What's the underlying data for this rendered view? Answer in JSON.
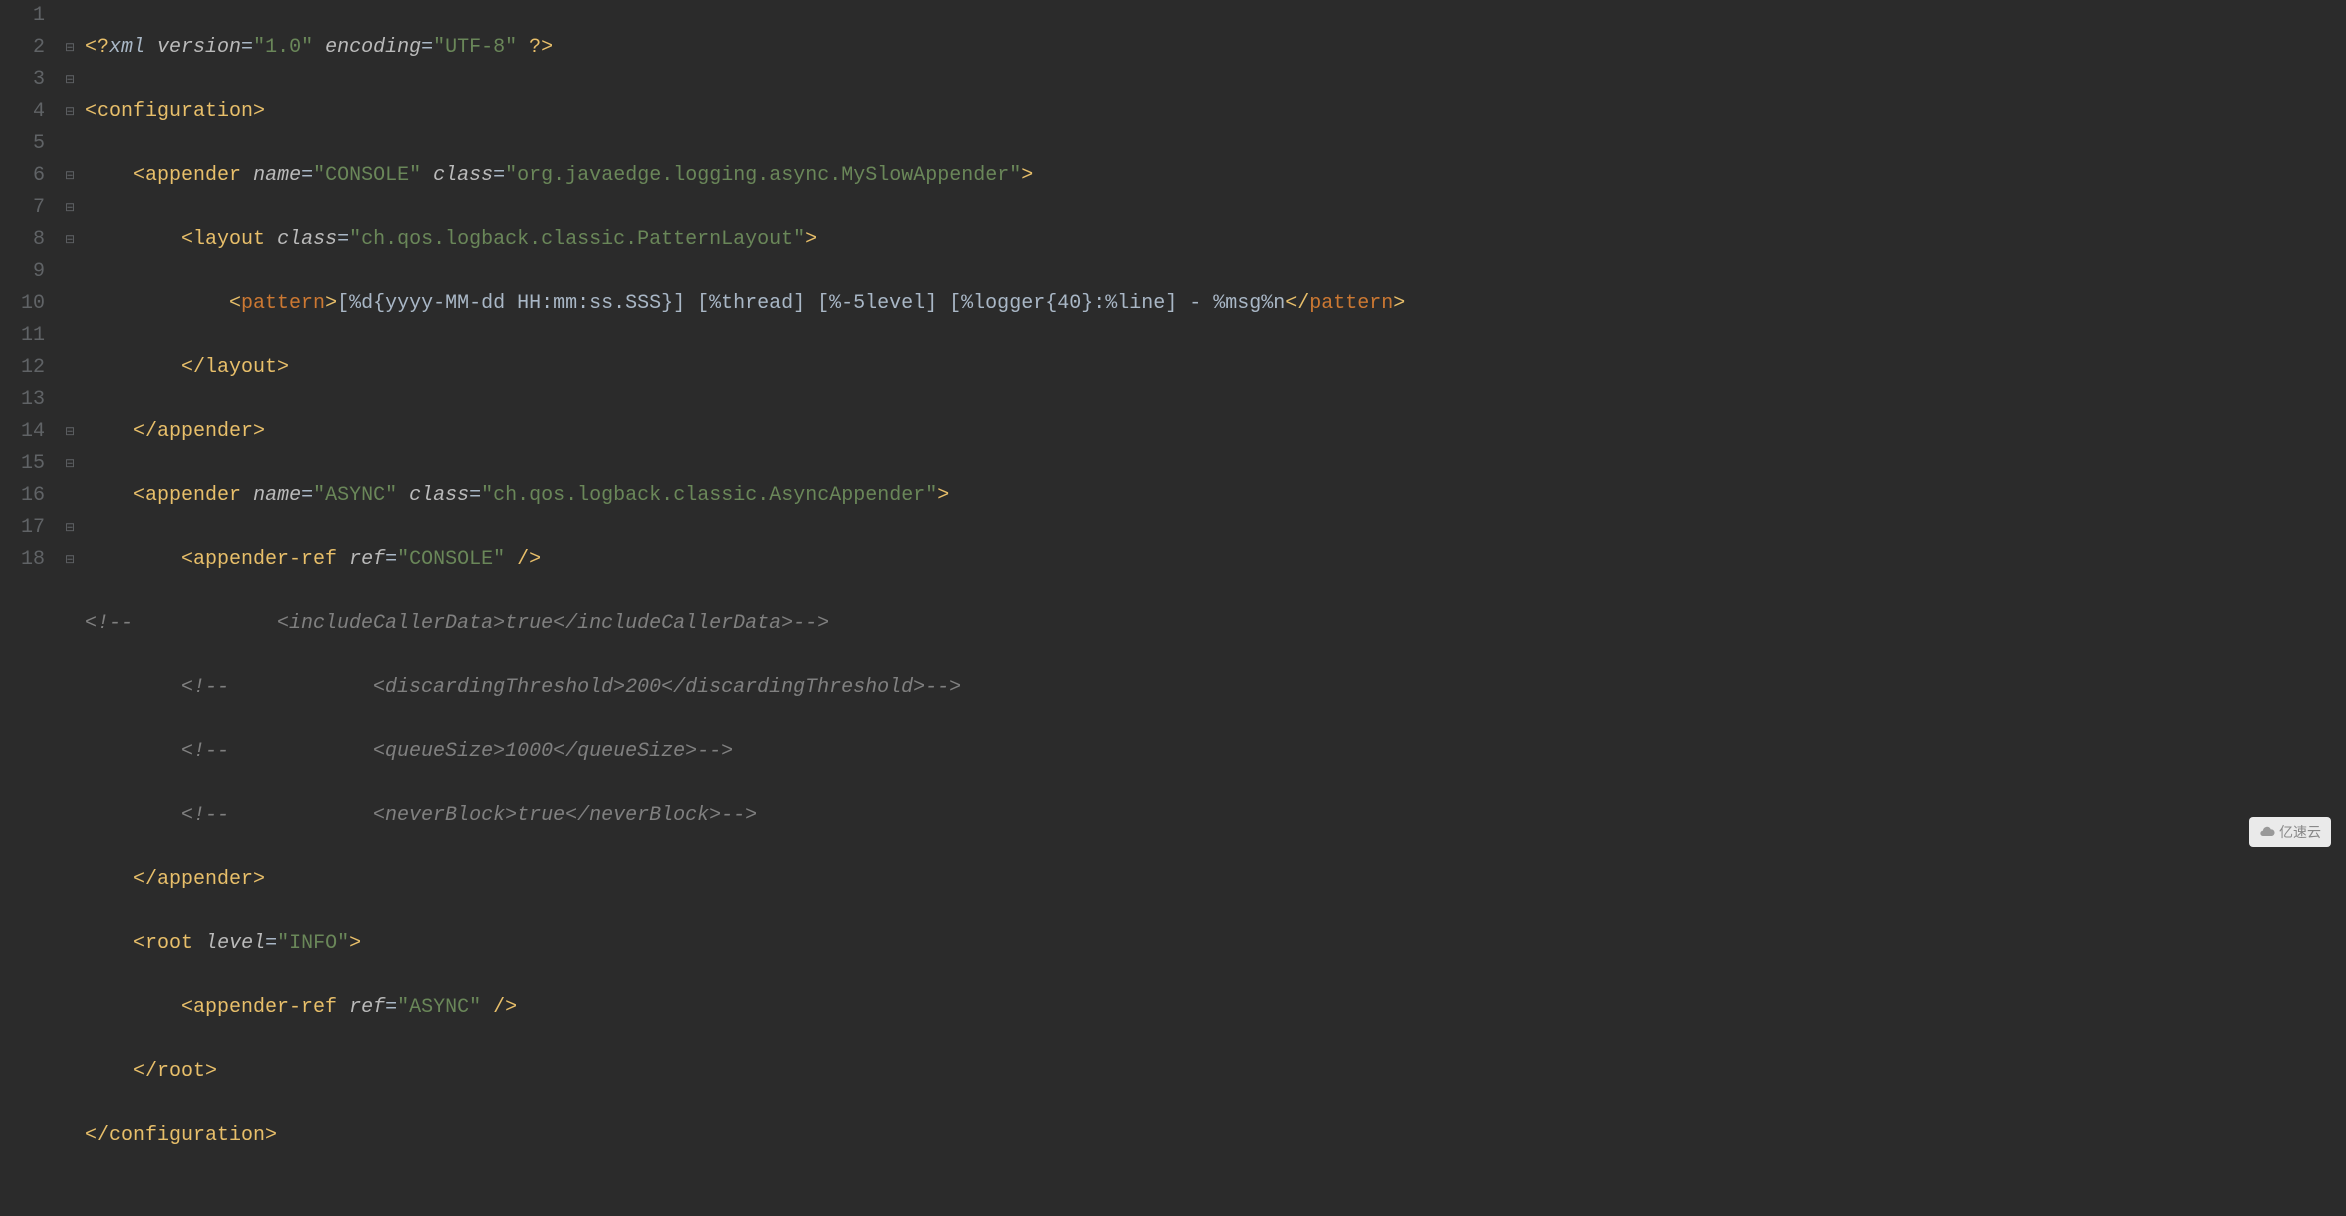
{
  "gutter": {
    "lines": [
      "1",
      "2",
      "3",
      "4",
      "5",
      "6",
      "7",
      "8",
      "9",
      "10",
      "11",
      "12",
      "13",
      "14",
      "15",
      "16",
      "17",
      "18"
    ]
  },
  "tokens": {
    "l1": {
      "p1": "<?",
      "p2": "xml ",
      "a1": "version",
      "eq": "=",
      "v1": "\"1.0\"",
      "sp": " ",
      "a2": "encoding",
      "v2": "\"UTF-8\"",
      "p3": " ?>"
    },
    "l2": {
      "o": "<",
      "tag": "configuration",
      "c": ">"
    },
    "l3": {
      "indent": "    ",
      "o": "<",
      "tag": "appender",
      "sp": " ",
      "a1": "name",
      "eq": "=",
      "v1": "\"CONSOLE\"",
      "sp2": " ",
      "a2": "class",
      "v2": "\"org.javaedge.logging.async.MySlowAppender\"",
      "c": ">"
    },
    "l4": {
      "indent": "        ",
      "o": "<",
      "tag": "layout",
      "sp": " ",
      "a1": "class",
      "eq": "=",
      "v1": "\"ch.qos.logback.classic.PatternLayout\"",
      "c": ">"
    },
    "l5": {
      "indent": "            ",
      "o": "<",
      "tag": "pattern",
      "c": ">",
      "text": "[%d{yyyy-MM-dd HH:mm:ss.SSS}] [%thread] [%-5level] [%logger{40}:%line] - %msg%n",
      "co": "</",
      "cc": ">"
    },
    "l6": {
      "indent": "        ",
      "o": "</",
      "tag": "layout",
      "c": ">"
    },
    "l7": {
      "indent": "    ",
      "o": "</",
      "tag": "appender",
      "c": ">"
    },
    "l8": {
      "indent": "    ",
      "o": "<",
      "tag": "appender",
      "sp": " ",
      "a1": "name",
      "eq": "=",
      "v1": "\"ASYNC\"",
      "sp2": " ",
      "a2": "class",
      "v2": "\"ch.qos.logback.classic.AsyncAppender\"",
      "c": ">"
    },
    "l9": {
      "indent": "        ",
      "o": "<",
      "tag": "appender-ref",
      "sp": " ",
      "a1": "ref",
      "eq": "=",
      "v1": "\"CONSOLE\"",
      "c": " />"
    },
    "l10": {
      "text": "<!--            <includeCallerData>true</includeCallerData>-->"
    },
    "l11": {
      "text": "        <!--            <discardingThreshold>200</discardingThreshold>-->"
    },
    "l12": {
      "text": "        <!--            <queueSize>1000</queueSize>-->"
    },
    "l13": {
      "text": "        <!--            <neverBlock>true</neverBlock>-->"
    },
    "l14": {
      "indent": "    ",
      "o": "</",
      "tag": "appender",
      "c": ">"
    },
    "l15": {
      "indent": "    ",
      "o": "<",
      "tag": "root",
      "sp": " ",
      "a1": "level",
      "eq": "=",
      "v1": "\"INFO\"",
      "c": ">"
    },
    "l16": {
      "indent": "        ",
      "o": "<",
      "tag": "appender-ref",
      "sp": " ",
      "a1": "ref",
      "eq": "=",
      "v1": "\"ASYNC\"",
      "c": " />"
    },
    "l17": {
      "indent": "    ",
      "o": "</",
      "tag": "root",
      "c": ">"
    },
    "l18": {
      "o": "</",
      "tag": "configuration",
      "c": ">"
    }
  },
  "watermark": {
    "text": "亿速云"
  }
}
